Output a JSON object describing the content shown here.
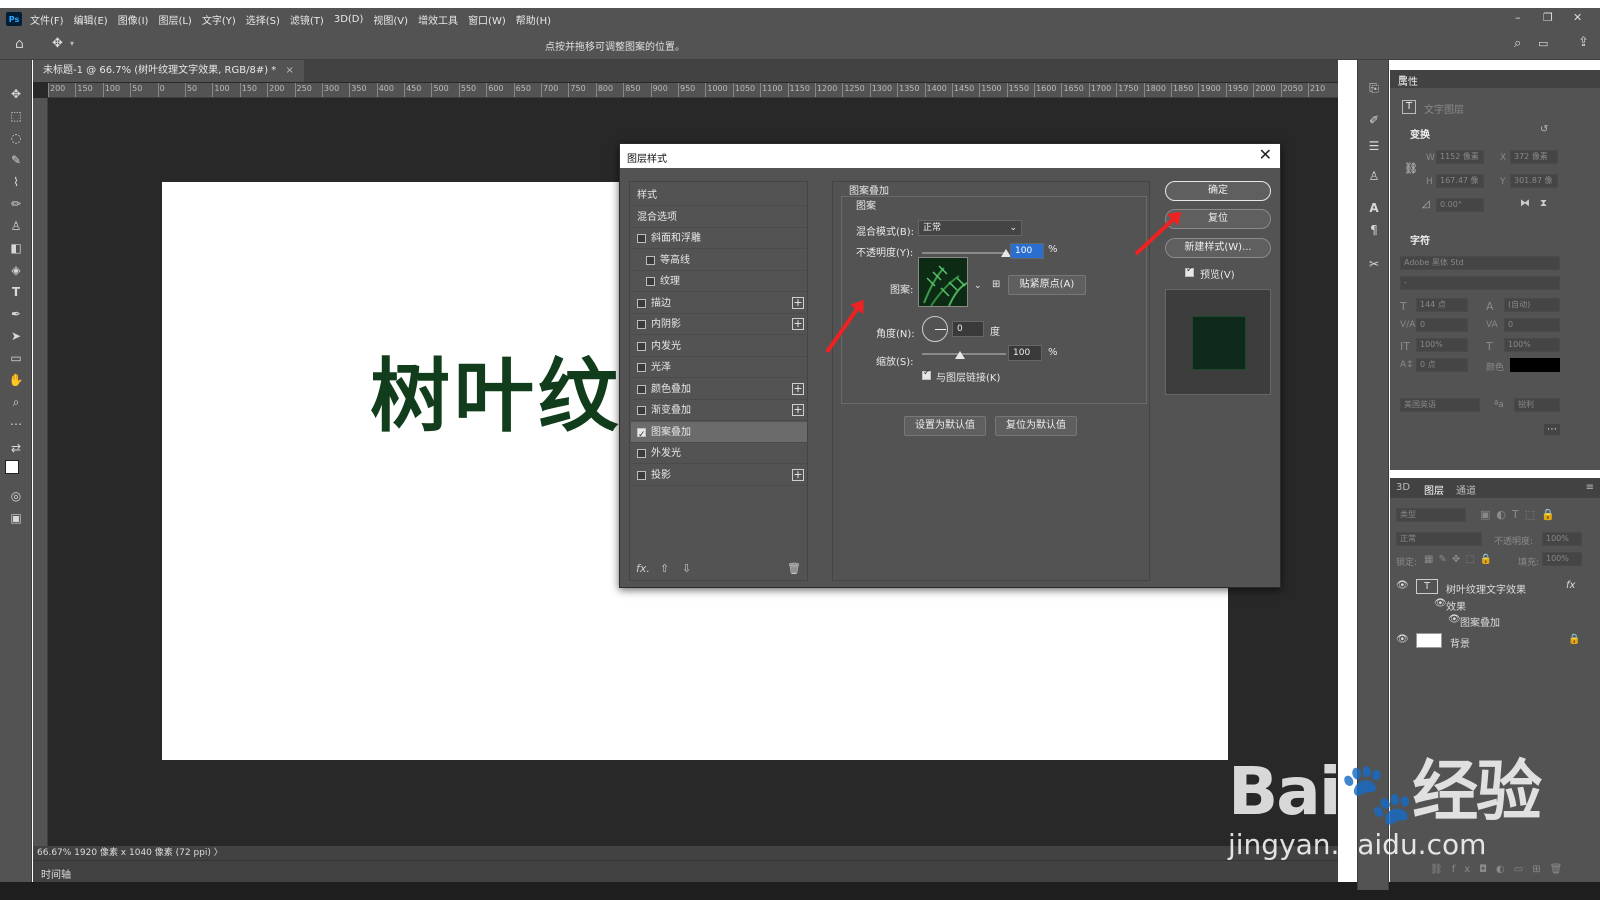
{
  "menubar": {
    "items": [
      "文件(F)",
      "编辑(E)",
      "图像(I)",
      "图层(L)",
      "文字(Y)",
      "选择(S)",
      "滤镜(T)",
      "3D(D)",
      "视图(V)",
      "增效工具",
      "窗口(W)",
      "帮助(H)"
    ]
  },
  "options": {
    "hint": "点按并拖移可调整图案的位置。"
  },
  "document": {
    "tab_label": "未标题-1 @ 66.7% (树叶纹理文字效果, RGB/8#) *",
    "canvas_text": "树叶纹理",
    "status": "66.67%   1920 像素 x 1040 像素 (72 ppi)   〉",
    "timeline_label": "时间轴",
    "ruler_ticks": [
      "200",
      "150",
      "100",
      "50",
      "0",
      "50",
      "100",
      "150",
      "200",
      "250",
      "300",
      "350",
      "400",
      "450",
      "500",
      "550",
      "600",
      "650",
      "700",
      "750",
      "800",
      "850",
      "900",
      "950",
      "1000",
      "1050",
      "1100",
      "1150",
      "1200",
      "1250",
      "1300",
      "1350",
      "1400",
      "1450",
      "1500",
      "1550",
      "1600",
      "1650",
      "1700",
      "1750",
      "1800",
      "1850",
      "1900",
      "1950",
      "2000",
      "2050",
      "210"
    ]
  },
  "dialog": {
    "title": "图层样式",
    "style_items": [
      {
        "label": "样式",
        "checkbox": false,
        "checked": false,
        "plus": false,
        "indent": 0
      },
      {
        "label": "混合选项",
        "checkbox": false,
        "checked": false,
        "plus": false,
        "indent": 0
      },
      {
        "label": "斜面和浮雕",
        "checkbox": true,
        "checked": false,
        "plus": false,
        "indent": 0
      },
      {
        "label": "等高线",
        "checkbox": true,
        "checked": false,
        "plus": false,
        "indent": 1
      },
      {
        "label": "纹理",
        "checkbox": true,
        "checked": false,
        "plus": false,
        "indent": 1
      },
      {
        "label": "描边",
        "checkbox": true,
        "checked": false,
        "plus": true,
        "indent": 0
      },
      {
        "label": "内阴影",
        "checkbox": true,
        "checked": false,
        "plus": true,
        "indent": 0
      },
      {
        "label": "内发光",
        "checkbox": true,
        "checked": false,
        "plus": false,
        "indent": 0
      },
      {
        "label": "光泽",
        "checkbox": true,
        "checked": false,
        "plus": false,
        "indent": 0
      },
      {
        "label": "颜色叠加",
        "checkbox": true,
        "checked": false,
        "plus": true,
        "indent": 0
      },
      {
        "label": "渐变叠加",
        "checkbox": true,
        "checked": false,
        "plus": true,
        "indent": 0
      },
      {
        "label": "图案叠加",
        "checkbox": true,
        "checked": true,
        "plus": false,
        "indent": 0,
        "selected": true
      },
      {
        "label": "外发光",
        "checkbox": true,
        "checked": false,
        "plus": false,
        "indent": 0
      },
      {
        "label": "投影",
        "checkbox": true,
        "checked": false,
        "plus": true,
        "indent": 0
      }
    ],
    "section_title": "图案叠加",
    "group_title": "图案",
    "blend_mode_label": "混合模式(B):",
    "blend_mode_value": "正常",
    "opacity_label": "不透明度(Y):",
    "opacity_value": "100",
    "opacity_unit": "%",
    "opacity_level": 1.0,
    "pattern_label": "图案:",
    "snap_origin_button": "贴紧原点(A)",
    "angle_label": "角度(N):",
    "angle_value": "0",
    "angle_unit": "度",
    "scale_label": "缩放(S):",
    "scale_value": "100",
    "scale_unit": "%",
    "link_label": "与图层链接(K)",
    "set_default_button": "设置为默认值",
    "reset_default_button": "复位为默认值",
    "ok_button": "确定",
    "reset_button": "复位",
    "new_style_button": "新建样式(W)...",
    "preview_label": "预览(V)",
    "list_footer_fx": "fx."
  },
  "properties": {
    "tab": "属性",
    "type_label": "文字图层",
    "transform_title": "变换",
    "w_label": "W",
    "w_value": "1152 像素",
    "x_label": "X",
    "x_value": "372 像素",
    "h_label": "H",
    "h_value": "167.47 像",
    "y_label": "Y",
    "y_value": "301.87 像",
    "angle_value": "0.00°",
    "char_title": "字符",
    "font_value": "Adobe 黑体 Std",
    "font_style_value": "-",
    "size_value": "144 点",
    "leading_value": "(自动)",
    "tracking_left": "0",
    "tracking_right": "0",
    "vscale_value": "100%",
    "hscale_value": "100%",
    "baseline_value": "0 点",
    "color_label": "颜色",
    "language_value": "美国英语",
    "aa_label": "锐利"
  },
  "layers": {
    "tabs": [
      "3D",
      "图层",
      "通道"
    ],
    "search_placeholder": "类型",
    "blend_value": "正常",
    "opacity_label": "不透明度:",
    "opacity_value": "100%",
    "lock_label": "锁定:",
    "fill_label": "填充:",
    "fill_value": "100%",
    "text_layer_name": "树叶纹理文字效果",
    "effects_label": "效果",
    "pattern_effect": "图案叠加",
    "bg_layer_name": "背景"
  },
  "watermark": {
    "logo": "Bai du 经验",
    "url": "jingyan.baidu.com"
  },
  "colors": {
    "accent_red": "#e22222",
    "canvas_text": "#113d1c",
    "ui_bg": "#535353"
  }
}
